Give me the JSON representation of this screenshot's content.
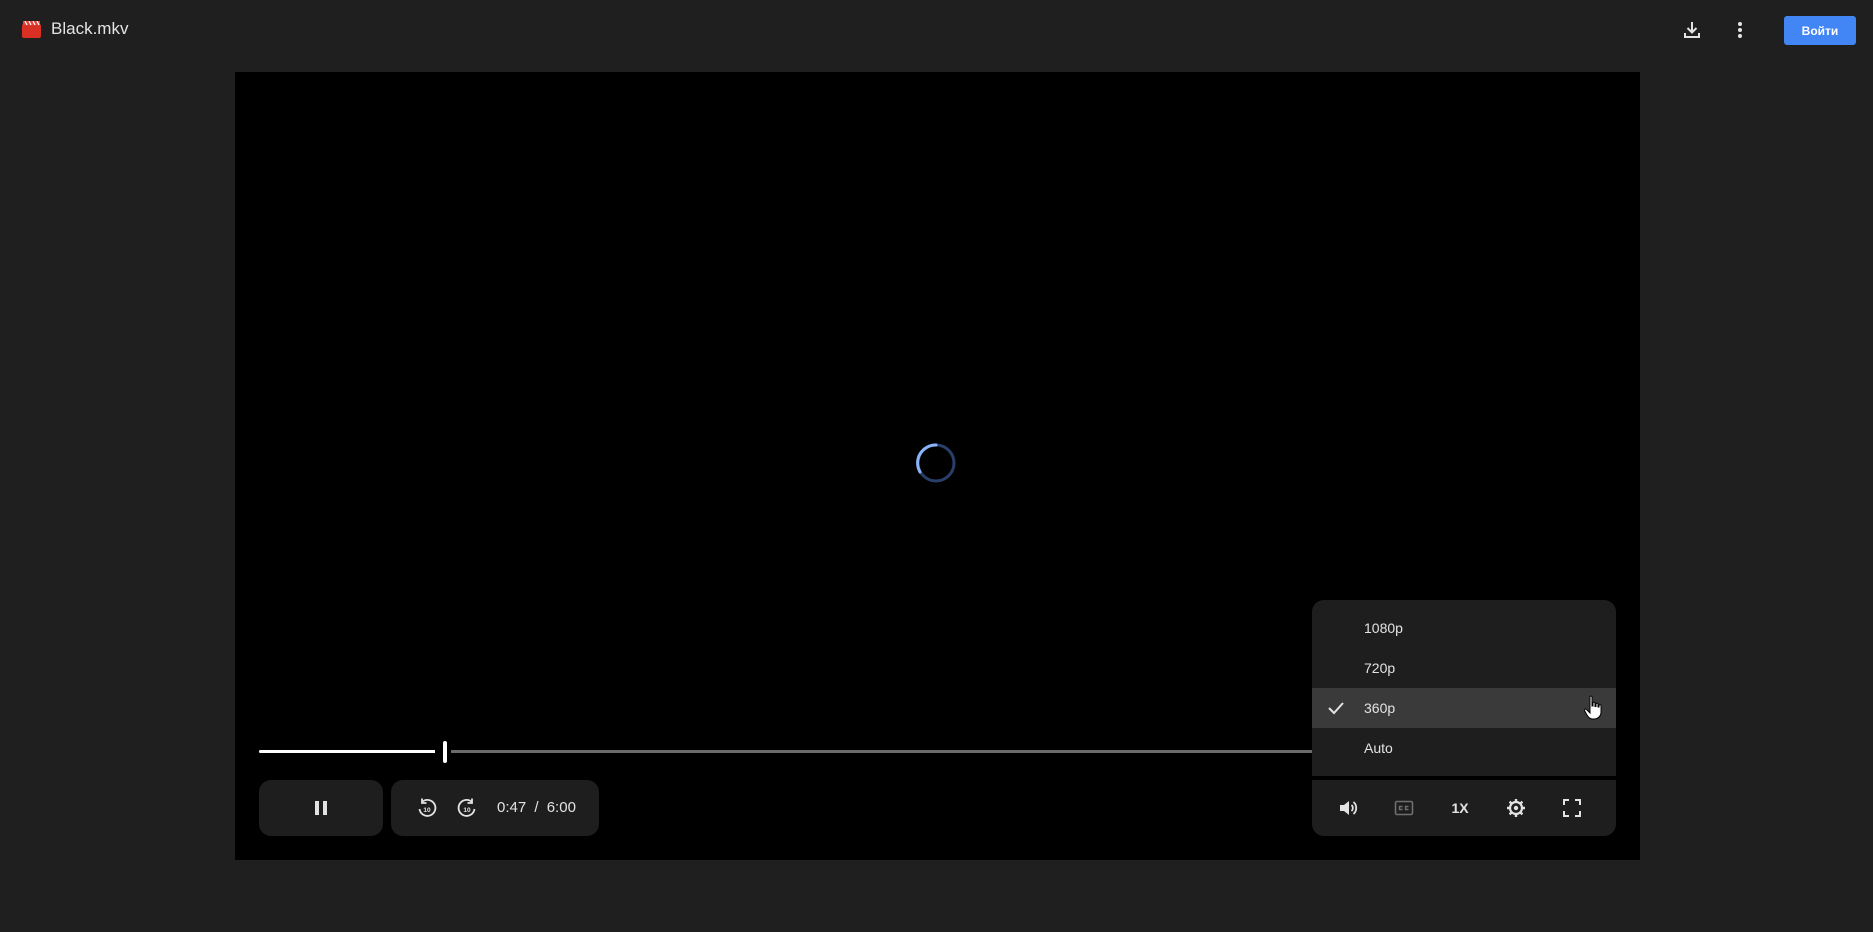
{
  "header": {
    "file_name": "Black.mkv",
    "file_icon": "video-file-icon",
    "sign_in_label": "Войти",
    "accent_color": "#4285f4"
  },
  "player": {
    "current_time": "0:47",
    "separator": "/",
    "duration": "6:00",
    "progress_fraction": 0.13,
    "speed_label": "1X",
    "loading": true
  },
  "quality_menu": {
    "options": [
      {
        "label": "1080p",
        "selected": false
      },
      {
        "label": "720p",
        "selected": false
      },
      {
        "label": "360p",
        "selected": true
      },
      {
        "label": "Auto",
        "selected": false
      }
    ]
  },
  "icons": {
    "download": "download-icon",
    "more": "more-vert-icon",
    "pause": "pause-icon",
    "rewind": "replay-10-icon",
    "forward": "forward-10-icon",
    "volume": "volume-icon",
    "captions": "closed-captions-icon",
    "settings": "gear-icon",
    "fullscreen": "fullscreen-icon"
  }
}
